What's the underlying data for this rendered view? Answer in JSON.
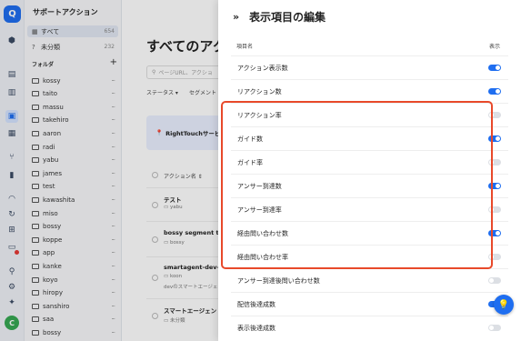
{
  "rail": {
    "logo": "Q",
    "avatar": "C"
  },
  "sidebar": {
    "title": "サポートアクション",
    "all": {
      "label": "すべて",
      "count": "654"
    },
    "uncategorized": {
      "label": "未分類",
      "count": "232"
    },
    "folders_label": "フォルダ",
    "add": "+",
    "folders": [
      "kossy",
      "taito",
      "massu",
      "takehiro",
      "aaron",
      "radi",
      "yabu",
      "james",
      "test",
      "kawashita",
      "miso",
      "bossy",
      "koppe",
      "app",
      "kanke",
      "koyo",
      "hiropy",
      "sanshiro",
      "saa",
      "bossy"
    ]
  },
  "main": {
    "title": "すべてのアク",
    "search_placeholder": "ページURL、アクショ",
    "filter_status": "ステータス ▾",
    "filter_segment": "セグメント",
    "banner": "RightTouchサービ",
    "col_action": "アクション名 ⇕",
    "rows": [
      {
        "title": "テスト",
        "sub": "yabu"
      },
      {
        "title": "bossy segment tes",
        "sub": "bossy"
      },
      {
        "title": "smartagent-dev-te",
        "sub": "koon",
        "sub2": "devのスマートエージェ"
      },
      {
        "title": "スマートエージェン",
        "sub": "未分類"
      }
    ]
  },
  "panel": {
    "title": "表示項目の編集",
    "collapse_icon": "»",
    "col_item": "項目名",
    "col_show": "表示",
    "items": [
      {
        "label": "アクション表示数",
        "on": true
      },
      {
        "label": "リアクション数",
        "on": true
      },
      {
        "label": "リアクション率",
        "on": false
      },
      {
        "label": "ガイド数",
        "on": true
      },
      {
        "label": "ガイド率",
        "on": false
      },
      {
        "label": "アンサー到達数",
        "on": true
      },
      {
        "label": "アンサー到達率",
        "on": false
      },
      {
        "label": "経由問い合わせ数",
        "on": true
      },
      {
        "label": "経由問い合わせ率",
        "on": false
      },
      {
        "label": "アンサー到達後問い合わせ数",
        "on": false
      },
      {
        "label": "配信後達成数",
        "on": true
      },
      {
        "label": "表示後達成数",
        "on": false
      }
    ]
  },
  "colors": {
    "accent": "#1f6ef0",
    "highlight": "#e8492a"
  }
}
